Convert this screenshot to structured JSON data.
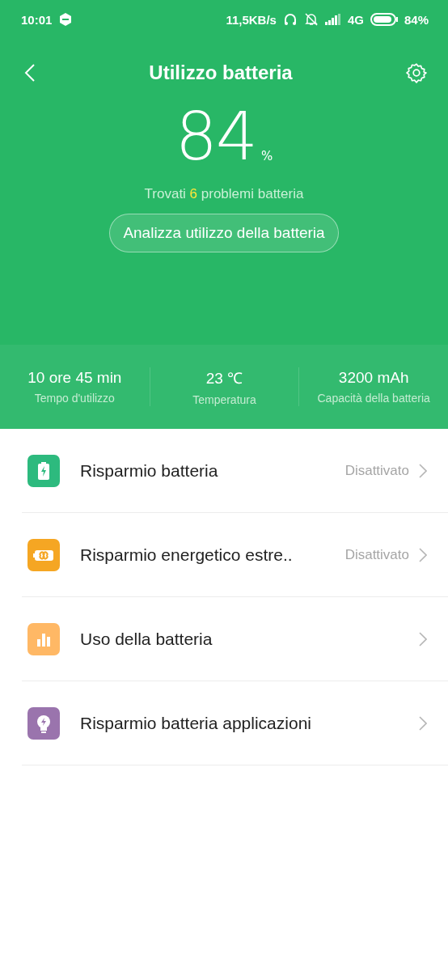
{
  "status_bar": {
    "time": "10:01",
    "speed": "11,5KB/s",
    "network": "4G",
    "battery_percent": "84%"
  },
  "header": {
    "title": "Utilizzo batteria"
  },
  "battery": {
    "value": "84",
    "unit": "%"
  },
  "problems": {
    "before": "Trovati ",
    "count": "6",
    "after": " problemi batteria"
  },
  "analyze_button": "Analizza utilizzo della batteria",
  "stats": [
    {
      "value": "10 ore 45 min",
      "label": "Tempo d'utilizzo"
    },
    {
      "value": "23 ℃",
      "label": "Temperatura"
    },
    {
      "value": "3200 mAh",
      "label": "Capacità della batteria"
    }
  ],
  "items": [
    {
      "kind": "battery",
      "color": "#2dba7e",
      "label": "Risparmio batteria",
      "status": "Disattivato"
    },
    {
      "kind": "infinity",
      "color": "#f5a623",
      "label": "Risparmio energetico estre..",
      "status": "Disattivato"
    },
    {
      "kind": "chart",
      "color": "#ffb865",
      "label": "Uso della batteria"
    },
    {
      "kind": "bulb",
      "color": "#9a74ad",
      "label": "Risparmio batteria applicazioni"
    }
  ]
}
